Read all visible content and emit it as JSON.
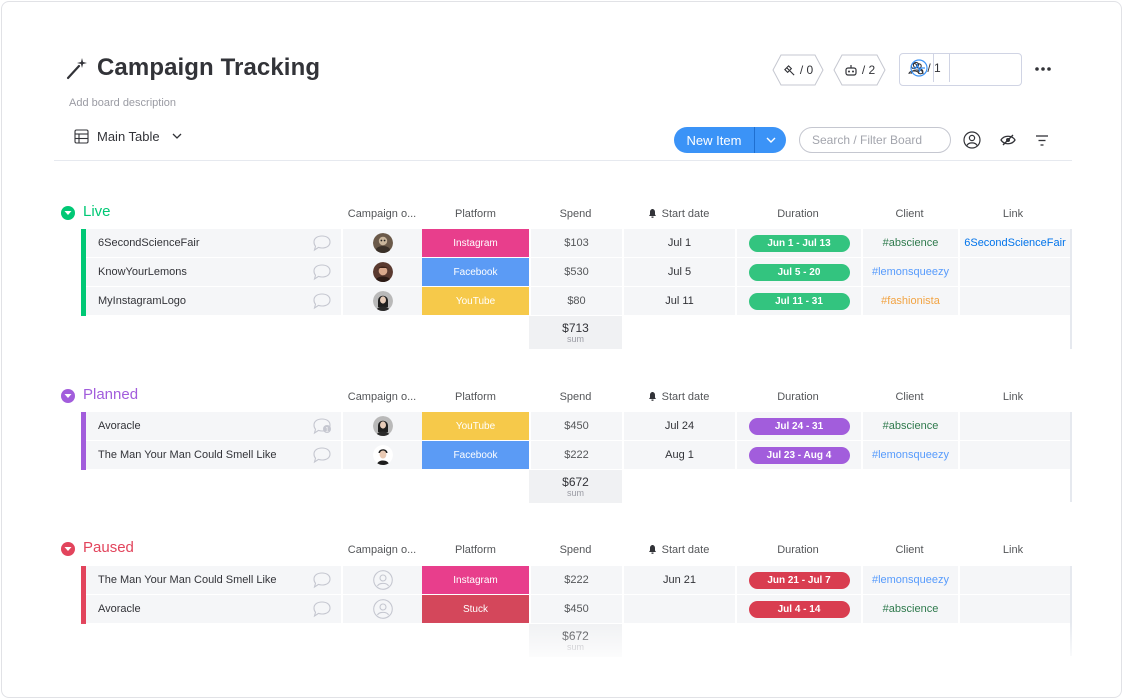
{
  "board": {
    "title": "Campaign Tracking",
    "description": "Add board description",
    "icon": "magic-wand-icon"
  },
  "header_counters": {
    "integrations": "/ 0",
    "automations": "/ 2",
    "members": "/ 1"
  },
  "toolbar": {
    "view_label": "Main Table",
    "new_item_label": "New Item",
    "search_placeholder": "Search / Filter Board"
  },
  "columns": {
    "owner": "Campaign o...",
    "platform": "Platform",
    "spend": "Spend",
    "start_date": "Start date",
    "duration": "Duration",
    "client": "Client",
    "link": "Link"
  },
  "colors": {
    "live": "#00c875",
    "planned": "#a25ddc",
    "paused": "#e2445c",
    "instagram": "#ff158a",
    "facebook": "#579bfc",
    "youtube": "#fdca42",
    "stuck": "#e2445c",
    "client_green": "#037f4c",
    "client_blue": "#579bfc",
    "client_orange": "#fdab3d"
  },
  "groups": [
    {
      "name": "Live",
      "color": "#00c875",
      "rows": [
        {
          "name": "6SecondScienceFair",
          "platform": "Instagram",
          "platform_color": "#e83e8c",
          "spend": "$103",
          "start": "Jul 1",
          "duration": "Jun 1 - Jul 13",
          "client": "#abscience",
          "client_color": "#2f7a4d",
          "link": "6SecondScienceFair"
        },
        {
          "name": "KnowYourLemons",
          "platform": "Facebook",
          "platform_color": "#5b9bf5",
          "spend": "$530",
          "start": "Jul 5",
          "duration": "Jul 5 - 20",
          "client": "#lemonsqueezy",
          "client_color": "#579bfc",
          "link": ""
        },
        {
          "name": "MyInstagramLogo",
          "platform": "YouTube",
          "platform_color": "#f6c94a",
          "spend": "$80",
          "start": "Jul 11",
          "duration": "Jul 11 - 31",
          "client": "#fashionista",
          "client_color": "#f2a444",
          "link": ""
        }
      ],
      "sum": "$713",
      "sum_label": "sum"
    },
    {
      "name": "Planned",
      "color": "#a25ddc",
      "rows": [
        {
          "name": "Avoracle",
          "platform": "YouTube",
          "platform_color": "#f6c94a",
          "spend": "$450",
          "start": "Jul 24",
          "duration": "Jul 24 - 31",
          "client": "#abscience",
          "client_color": "#2f7a4d",
          "link": ""
        },
        {
          "name": "The Man Your Man Could Smell Like",
          "platform": "Facebook",
          "platform_color": "#5b9bf5",
          "spend": "$222",
          "start": "Aug 1",
          "duration": "Jul 23 - Aug 4",
          "client": "#lemonsqueezy",
          "client_color": "#579bfc",
          "link": ""
        }
      ],
      "sum": "$672",
      "sum_label": "sum"
    },
    {
      "name": "Paused",
      "color": "#e2445c",
      "rows": [
        {
          "name": "The Man Your Man Could Smell Like",
          "platform": "Instagram",
          "platform_color": "#e83e8c",
          "spend": "$222",
          "start": "Jun 21",
          "duration": "Jun 21 - Jul 7",
          "client": "#lemonsqueezy",
          "client_color": "#579bfc",
          "link": ""
        },
        {
          "name": "Avoracle",
          "platform": "Stuck",
          "platform_color": "#d4475b",
          "spend": "$450",
          "start": "",
          "duration": "Jul 4 - 14",
          "client": "#abscience",
          "client_color": "#2f7a4d",
          "link": ""
        }
      ],
      "sum": "$672",
      "sum_label": "sum"
    }
  ]
}
